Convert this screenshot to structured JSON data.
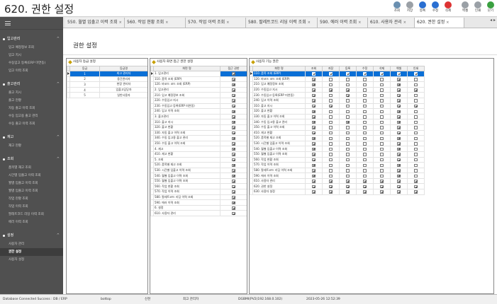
{
  "app": {
    "title": "620. 권한 설정"
  },
  "toolbar": [
    {
      "label": "조회",
      "icon": "search-icon",
      "color": "#6a8fb0"
    },
    {
      "label": "저장",
      "icon": "download-icon",
      "color": "#9aa0a6"
    },
    {
      "label": "등록",
      "icon": "add-icon",
      "color": "#2a6fd1"
    },
    {
      "label": "수정",
      "icon": "edit-icon",
      "color": "#2a6fd1"
    },
    {
      "label": "삭제",
      "icon": "delete-icon",
      "color": "#d33"
    },
    {
      "label": "엑셀",
      "icon": "excel-icon",
      "color": "#9aa0a6"
    },
    {
      "label": "인쇄",
      "icon": "print-icon",
      "color": "#9aa0a6"
    },
    {
      "label": "닫기",
      "icon": "exit-icon",
      "color": "#3aa040"
    }
  ],
  "sidebar": {
    "groups": [
      {
        "label": "입고관리",
        "items": [
          "입고 예정정보 조회",
          "입고 지시",
          "수동입고 등록(ERP 미연동)",
          "입고 이력 조회"
        ]
      },
      {
        "label": "출고관리",
        "items": [
          "출고 지시",
          "출고 현황",
          "자동 출고 이력 조회",
          "수동 입고용 출고 관리",
          "수동 출고 이력 조회"
        ]
      },
      {
        "label": "재고",
        "items": [
          "재고 현황"
        ]
      },
      {
        "label": "조회",
        "items": [
          "품목별 재고 조회",
          "시간별 입출고 이력 조회",
          "월별 입출고 이력 조회",
          "월별 입출고 이력 조회",
          "작업 현황 조회",
          "작업 이력 조회",
          "팔레트코드 리딩 이력 조회",
          "에러 이력 조회"
        ]
      },
      {
        "label": "설정",
        "items": [
          "사용자 관리",
          "권한 설정",
          "사용자 설정"
        ]
      }
    ],
    "active": "권한 설정"
  },
  "tabs": [
    "550. 월별 입출고 이력 조회",
    "560. 작업 현황 조회",
    "570. 작업 이력 조회",
    "580. 팔레트코드 리딩 이력 조회",
    "590. 에러 이력 조회",
    "610. 사용자 관리",
    "620. 권한 설정"
  ],
  "tab_scroll": "◂ ▸",
  "page": {
    "title": "권한 설정"
  },
  "grade_panel": {
    "title": "사용자 등급 설정",
    "columns": [
      "등급",
      "등급명"
    ],
    "rows": [
      {
        "grade": "1",
        "name": "최고 관리자"
      },
      {
        "grade": "2",
        "name": "중간관리자"
      },
      {
        "grade": "3",
        "name": "현장 관리자"
      },
      {
        "grade": "4",
        "name": "입출고담당자"
      },
      {
        "grade": "5",
        "name": "일반사용자"
      }
    ]
  },
  "screen_panel": {
    "title": "사용자 화면 접근 권한 설정",
    "columns": [
      "화면 명",
      "접근 권한"
    ],
    "rows": [
      {
        "name": "1. 입고관리",
        "checked": true
      },
      {
        "name": "110. 품목 조회 (ERP)",
        "checked": true
      },
      {
        "name": "120. 바코드 코드 조회 (ERP)",
        "checked": true
      },
      {
        "name": "2. 입고관리",
        "checked": true
      },
      {
        "name": "210. 입고 예정정보 조회",
        "checked": true
      },
      {
        "name": "220. 수동입고 지시",
        "checked": true
      },
      {
        "name": "230. 수동입고 등록(ERP 미연동)",
        "checked": true
      },
      {
        "name": "240. 입고 이력 조회",
        "checked": true
      },
      {
        "name": "3. 출고관리",
        "checked": true
      },
      {
        "name": "310. 출고 지시",
        "checked": true
      },
      {
        "name": "320. 출고 현황",
        "checked": true
      },
      {
        "name": "330. 자동 출고 이력 조회",
        "checked": true
      },
      {
        "name": "340. 수동 입고용 출고 관리",
        "checked": true
      },
      {
        "name": "350. 수동 출고 이력 조회",
        "checked": true
      },
      {
        "name": "4. 재고",
        "checked": true
      },
      {
        "name": "410. 재고 현황",
        "checked": true
      },
      {
        "name": "5. 조회",
        "checked": true
      },
      {
        "name": "520. 품목별 재고 조회",
        "checked": true
      },
      {
        "name": "530. 시간별 입출고 이력 조회",
        "checked": true
      },
      {
        "name": "540. 월별 입출고 이력 조회",
        "checked": true
      },
      {
        "name": "550. 월별 입출고 이력 조회",
        "checked": true
      },
      {
        "name": "560. 작업 현황 조회",
        "checked": true
      },
      {
        "name": "570. 작업 이력 조회",
        "checked": true
      },
      {
        "name": "580. 팔레트코드 리딩 이력 조회",
        "checked": true
      },
      {
        "name": "590. 에러 이력 조회",
        "checked": true
      },
      {
        "name": "6. 설정",
        "checked": true
      },
      {
        "name": "610. 사용자 관리",
        "checked": true
      }
    ]
  },
  "func_panel": {
    "title": "사용자 기능 권한",
    "columns": [
      "화면 명",
      "조회",
      "저장",
      "등록",
      "수정",
      "삭제",
      "엑셀",
      "인쇄"
    ],
    "rows": [
      {
        "name": "110. 품목 조회 (ERP)",
        "flags": [
          1,
          1,
          1,
          1,
          1,
          1,
          1
        ]
      },
      {
        "name": "120. 바코드 코드 조회 (ERP)",
        "flags": [
          1,
          0,
          0,
          0,
          0,
          1,
          0
        ]
      },
      {
        "name": "210. 입고 예정정보 조회",
        "flags": [
          1,
          0,
          0,
          0,
          0,
          1,
          0
        ]
      },
      {
        "name": "220. 수동입고 지시",
        "flags": [
          1,
          1,
          1,
          0,
          0,
          1,
          1
        ]
      },
      {
        "name": "230. 수동입고 등록(ERP 미연동)",
        "flags": [
          1,
          0,
          1,
          0,
          0,
          1,
          0
        ]
      },
      {
        "name": "240. 입고 이력 조회",
        "flags": [
          1,
          0,
          0,
          0,
          0,
          1,
          0
        ]
      },
      {
        "name": "310. 출고 지시",
        "flags": [
          1,
          1,
          0,
          0,
          0,
          1,
          1
        ]
      },
      {
        "name": "320. 출고 현황",
        "flags": [
          1,
          0,
          0,
          0,
          0,
          1,
          0
        ]
      },
      {
        "name": "330. 자동 출고 이력 조회",
        "flags": [
          1,
          0,
          0,
          0,
          0,
          1,
          0
        ]
      },
      {
        "name": "340. 수동 입고용 출고 관리",
        "flags": [
          1,
          0,
          1,
          0,
          0,
          1,
          0
        ]
      },
      {
        "name": "350. 수동 출고 이력 조회",
        "flags": [
          1,
          0,
          0,
          0,
          0,
          1,
          0
        ]
      },
      {
        "name": "410. 재고 현황",
        "flags": [
          1,
          0,
          0,
          0,
          0,
          1,
          0
        ]
      },
      {
        "name": "520. 품목별 재고 조회",
        "flags": [
          1,
          0,
          0,
          0,
          0,
          1,
          0
        ]
      },
      {
        "name": "530. 시간별 입출고 이력 조회",
        "flags": [
          1,
          0,
          0,
          0,
          0,
          1,
          0
        ]
      },
      {
        "name": "540. 월별 입출고 이력 조회",
        "flags": [
          1,
          0,
          0,
          0,
          0,
          1,
          0
        ]
      },
      {
        "name": "550. 월별 입출고 이력 조회",
        "flags": [
          1,
          0,
          0,
          0,
          0,
          1,
          0
        ]
      },
      {
        "name": "560. 작업 현황 조회",
        "flags": [
          1,
          0,
          0,
          0,
          0,
          1,
          0
        ]
      },
      {
        "name": "570. 작업 이력 조회",
        "flags": [
          1,
          0,
          0,
          0,
          0,
          1,
          0
        ]
      },
      {
        "name": "580. 팔레트코드 리딩 이력 조회",
        "flags": [
          1,
          0,
          0,
          0,
          0,
          1,
          0
        ]
      },
      {
        "name": "590. 에러 이력 조회",
        "flags": [
          1,
          0,
          0,
          0,
          0,
          1,
          0
        ]
      },
      {
        "name": "610. 사용자 관리",
        "flags": [
          1,
          1,
          1,
          1,
          1,
          1,
          1
        ]
      },
      {
        "name": "620. 권한 설정",
        "flags": [
          1,
          1,
          1,
          1,
          1,
          1,
          1
        ]
      },
      {
        "name": "630. 사용자 설정",
        "flags": [
          1,
          1,
          1,
          1,
          1,
          1,
          1
        ]
      }
    ]
  },
  "status": {
    "connection": "Database Connected Success : DB / ERP",
    "user": "bottop",
    "site": "신천",
    "role": "최고 관리자",
    "server": "DGBMI(PV2(192.168.0.102)",
    "datetime": "2023-05-26 12:52:39"
  }
}
